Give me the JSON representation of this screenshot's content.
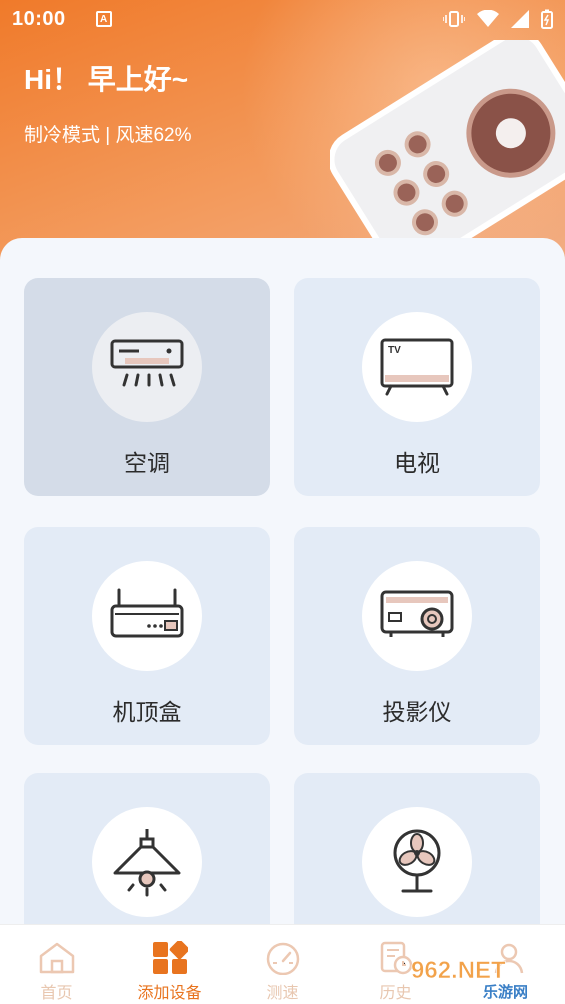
{
  "status_bar": {
    "time": "10:00",
    "notification_letter": "A"
  },
  "header": {
    "greeting": "Hi！ 早上好~",
    "status_text": "制冷模式 | 风速62%"
  },
  "devices": [
    {
      "label": "空调",
      "icon": "air-conditioner-icon",
      "selected": true
    },
    {
      "label": "电视",
      "icon": "tv-icon",
      "screen_text": "TV",
      "selected": false
    },
    {
      "label": "机顶盒",
      "icon": "set-top-box-icon",
      "selected": false
    },
    {
      "label": "投影仪",
      "icon": "projector-icon",
      "selected": false
    },
    {
      "label": "",
      "icon": "lamp-icon",
      "selected": false
    },
    {
      "label": "",
      "icon": "fan-icon",
      "selected": false
    }
  ],
  "nav": [
    {
      "label": "首页",
      "icon": "home-icon",
      "active": false
    },
    {
      "label": "添加设备",
      "icon": "add-device-icon",
      "active": true
    },
    {
      "label": "测速",
      "icon": "speedometer-icon",
      "active": false
    },
    {
      "label": "历史",
      "icon": "history-icon",
      "active": false
    },
    {
      "label": "",
      "icon": "profile-icon",
      "active": false
    }
  ],
  "watermark": {
    "main": "962.NET",
    "sub": "乐游网"
  },
  "colors": {
    "accent": "#e8741f",
    "card_bg": "#e3ebf6",
    "icon_brown": "#8a5248"
  }
}
